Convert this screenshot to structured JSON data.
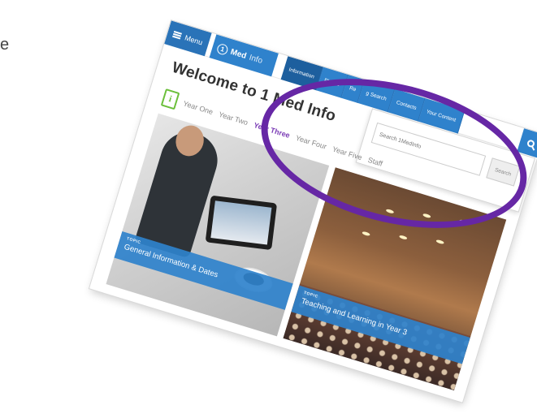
{
  "stray_char": "e",
  "header": {
    "menu_label": "Menu",
    "logo_icon_char": "1",
    "logo_brand": "Med",
    "logo_sub": "Info",
    "nav": [
      {
        "label": "Information",
        "active": true
      },
      {
        "label": "Places"
      },
      {
        "label": "Re"
      },
      {
        "label": "g Search"
      },
      {
        "label": "Contacts"
      },
      {
        "label": "Your Content"
      }
    ]
  },
  "search": {
    "placeholder": "Search 1MedInfo",
    "button_label": "Search"
  },
  "main": {
    "title": "Welcome to 1 Med Info",
    "year_icon_char": "i",
    "year_tabs": [
      {
        "label": "Year One"
      },
      {
        "label": "Year Two"
      },
      {
        "label": "Year Three",
        "active": true
      },
      {
        "label": "Year Four"
      },
      {
        "label": "Year Five"
      },
      {
        "label": "Staff"
      }
    ],
    "tiles": [
      {
        "kicker": "TOPIC",
        "title": "General Information & Dates"
      },
      {
        "kicker": "TOPIC",
        "title": "Teaching and Learning in Year 3"
      }
    ]
  },
  "colors": {
    "primary_blue": "#2f82cc",
    "active_year": "#7a3bb5",
    "annotation_ring": "#6627a5",
    "info_icon_green": "#6bbf3a"
  }
}
